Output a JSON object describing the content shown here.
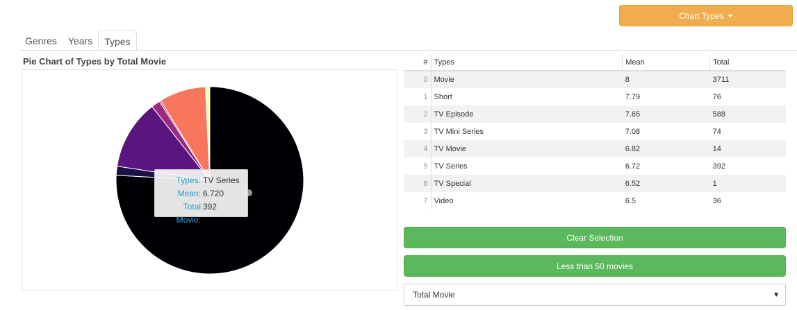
{
  "toolbar": {
    "chart_types_label": "Chart Types"
  },
  "tabs": [
    {
      "label": "Genres"
    },
    {
      "label": "Years"
    },
    {
      "label": "Types",
      "active": true
    }
  ],
  "chart_data": {
    "type": "pie",
    "title": "Pie Chart of Types by Total Movie",
    "categories": [
      "Movie",
      "Short",
      "TV Episode",
      "TV Mini Series",
      "TV Movie",
      "TV Series",
      "TV Special",
      "Video"
    ],
    "values": [
      3711,
      76,
      588,
      74,
      14,
      392,
      1,
      36
    ],
    "colors": [
      "#000004",
      "#1c1044",
      "#5a167e",
      "#9a2a80",
      "#c33d80",
      "#f8765c",
      "#fed395",
      "#fcfdbf"
    ],
    "tooltip": {
      "types_label": "Types:",
      "types_value": "TV Series",
      "mean_label": "Mean:",
      "mean_value": "6.720",
      "total_label": "Total Movie:",
      "total_value": "392"
    }
  },
  "table": {
    "headers": [
      "#",
      "Types",
      "Mean",
      "Total"
    ],
    "rows": [
      [
        "0",
        "Movie",
        "8",
        "3711"
      ],
      [
        "1",
        "Short",
        "7.79",
        "76"
      ],
      [
        "2",
        "TV Episode",
        "7.65",
        "588"
      ],
      [
        "3",
        "TV Mini Series",
        "7.08",
        "74"
      ],
      [
        "4",
        "TV Movie",
        "6.82",
        "14"
      ],
      [
        "5",
        "TV Series",
        "6.72",
        "392"
      ],
      [
        "6",
        "TV Special",
        "6.52",
        "1"
      ],
      [
        "7",
        "Video",
        "6.5",
        "36"
      ]
    ]
  },
  "buttons": {
    "clear_selection": "Clear Selection",
    "less_than_50": "Less than 50 movies"
  },
  "select": {
    "value": "Total Movie"
  }
}
